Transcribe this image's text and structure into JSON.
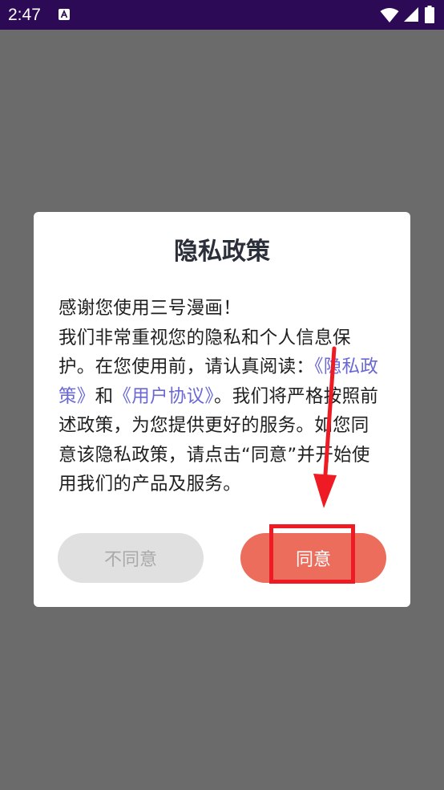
{
  "status_bar": {
    "time": "2:47",
    "icons": [
      "a-notification-icon",
      "wifi-icon",
      "signal-icon",
      "battery-icon"
    ]
  },
  "dialog": {
    "title": "隐私政策",
    "greeting": "感谢您使用三号漫画！",
    "body_part1": "我们非常重视您的隐私和个人信息保护。在您使用前，请认真阅读：",
    "privacy_link": "《隐私政策》",
    "connector": "和",
    "user_agreement_link": "《用户协议》",
    "body_part2": "。我们将严格按照前述政策，为您提供更好的服务。如您同意该隐私政策，请点击“同意”并开始使用我们的产品及服务。",
    "disagree_label": "不同意",
    "agree_label": "同意"
  },
  "colors": {
    "status_bar": "#2d0a55",
    "overlay": "#6b6b6b",
    "link": "#6a68d6",
    "agree_button": "#ed6d5c",
    "disagree_button": "#e0e0e0",
    "annotation": "#ee1b24"
  }
}
